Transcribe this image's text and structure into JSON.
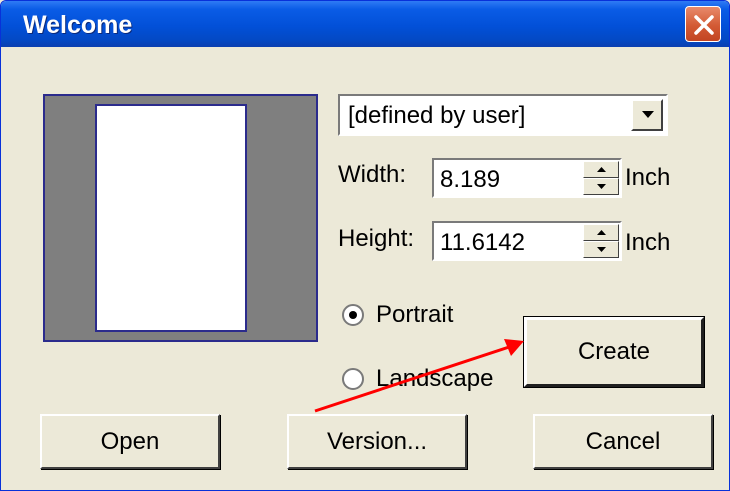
{
  "window": {
    "title": "Welcome",
    "close_icon": "close-icon",
    "accent_color": "#0250d8",
    "close_color": "#d35a34"
  },
  "paper_size": {
    "selected": "[defined by user]"
  },
  "width": {
    "label": "Width:",
    "value": "8.189",
    "unit": "Inch"
  },
  "height": {
    "label": "Height:",
    "value": "11.6142",
    "unit": "Inch"
  },
  "orientation": {
    "portrait_label": "Portrait",
    "landscape_label": "Landscape",
    "selected": "Portrait"
  },
  "buttons": {
    "create": "Create",
    "open": "Open",
    "version": "Version...",
    "cancel": "Cancel"
  },
  "annotation": {
    "arrow_color": "#ff0000"
  }
}
